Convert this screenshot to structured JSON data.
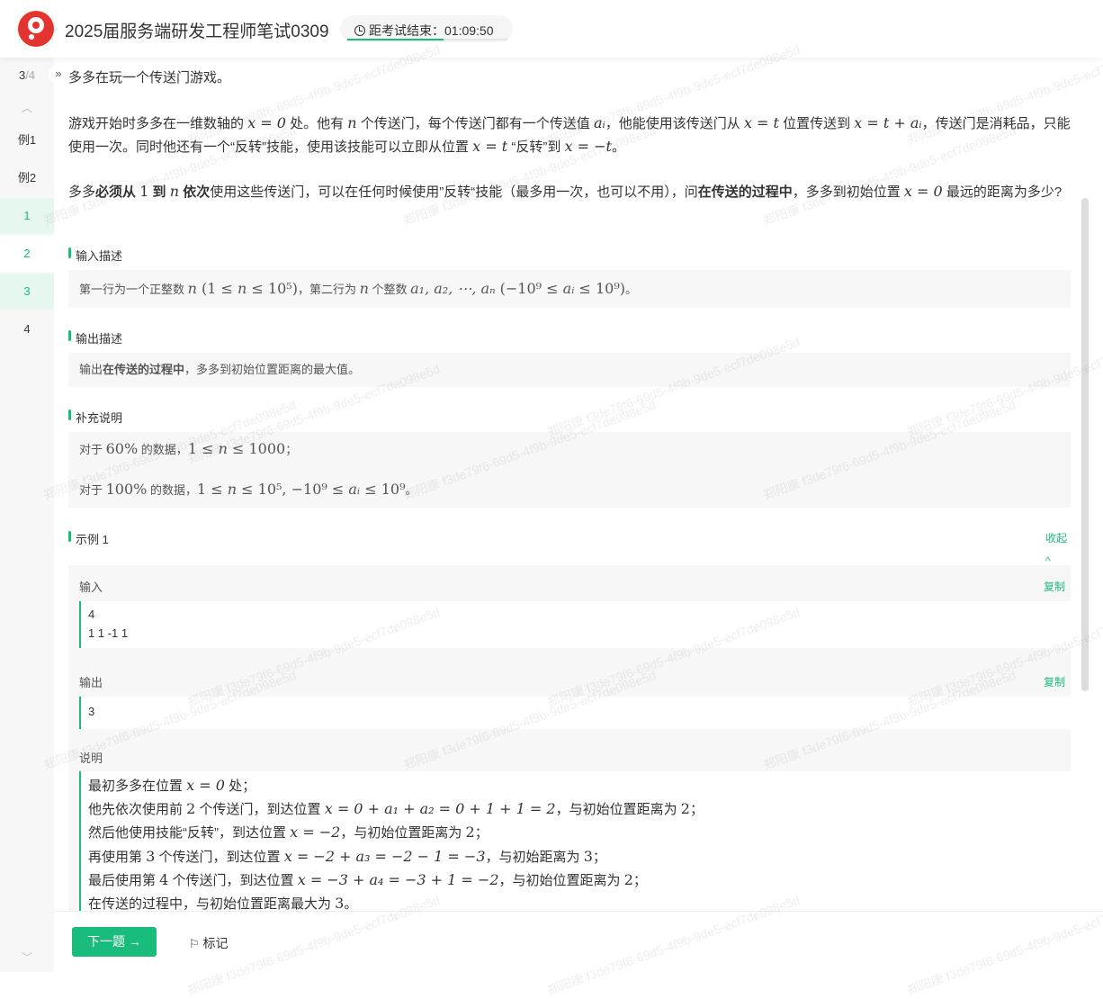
{
  "header": {
    "title": "2025届服务端研发工程师笔试0309",
    "timer_label": "距考试结束：",
    "timer_value": "01:09:50",
    "timer_progress": 0.6
  },
  "sidebar": {
    "progress_current": "3",
    "progress_total": "/4",
    "items": [
      "例1",
      "例2",
      "1",
      "2",
      "3",
      "4"
    ]
  },
  "problem": {
    "p1": "多多在玩一个传送门游戏。",
    "p2": [
      [
        "t",
        "游戏开始时多多在一维数轴的 "
      ],
      [
        "m",
        "x = 0"
      ],
      [
        "t",
        " 处。他有 "
      ],
      [
        "m",
        "n"
      ],
      [
        "t",
        " 个传送门，每个传送门都有一个传送值 "
      ],
      [
        "m",
        "aᵢ"
      ],
      [
        "t",
        "，他能使用该传送门从 "
      ],
      [
        "m",
        "x = t"
      ],
      [
        "t",
        " 位置传送到 "
      ],
      [
        "m",
        "x = t + aᵢ"
      ],
      [
        "t",
        "，传送门是消耗品，只能使用一次。同时他还有一个“反转”技能，使用该技能可以立即从位置 "
      ],
      [
        "m",
        "x = t"
      ],
      [
        "t",
        " “反转”到 "
      ],
      [
        "m",
        "x = −t"
      ],
      [
        "t",
        "。"
      ]
    ],
    "p3": [
      [
        "t",
        "多多"
      ],
      [
        "b",
        "必须从 "
      ],
      [
        "mn",
        "1"
      ],
      [
        "b",
        " 到 "
      ],
      [
        "m",
        "n"
      ],
      [
        "b",
        " 依次"
      ],
      [
        "t",
        "使用这些传送门，可以在任何时候使用”反转“技能（最多用一次，也可以不用），问"
      ],
      [
        "b",
        "在传送的过程中"
      ],
      [
        "t",
        "，多多到初始位置 "
      ],
      [
        "m",
        "x = 0"
      ],
      [
        "t",
        " 最远的距离为多少?"
      ]
    ]
  },
  "input_desc": {
    "title": "输入描述",
    "body": [
      [
        "t",
        "第一行为一个正整数 "
      ],
      [
        "m",
        "n"
      ],
      [
        "mn",
        " (1 ≤ "
      ],
      [
        "m",
        "n"
      ],
      [
        "mn",
        " ≤ 10⁵)"
      ],
      [
        "t",
        "，第二行为 "
      ],
      [
        "m",
        "n"
      ],
      [
        "t",
        " 个整数 "
      ],
      [
        "m",
        "a₁, a₂, ⋯, aₙ"
      ],
      [
        "mn",
        " (−10⁹ ≤ "
      ],
      [
        "m",
        "aᵢ"
      ],
      [
        "mn",
        " ≤ 10⁹)"
      ],
      [
        "t",
        "。"
      ]
    ]
  },
  "output_desc": {
    "title": "输出描述",
    "body": [
      [
        "t",
        "输出"
      ],
      [
        "b",
        "在传送的过程中"
      ],
      [
        "t",
        "，多多到初始位置距离的最大值。"
      ]
    ]
  },
  "notes": {
    "title": "补充说明",
    "lines": [
      [
        [
          "t",
          "对于 "
        ],
        [
          "mn",
          "60%"
        ],
        [
          "t",
          " 的数据，"
        ],
        [
          "mn",
          "1 ≤ "
        ],
        [
          "m",
          "n"
        ],
        [
          "mn",
          " ≤ 1000"
        ],
        [
          "t",
          "；"
        ]
      ],
      [
        [
          "t",
          "对于 "
        ],
        [
          "mn",
          "100%"
        ],
        [
          "t",
          " 的数据，"
        ],
        [
          "mn",
          "1 ≤ "
        ],
        [
          "m",
          "n"
        ],
        [
          "mn",
          " ≤ 10⁵, −10⁹ ≤ "
        ],
        [
          "m",
          "aᵢ"
        ],
        [
          "mn",
          " ≤ 10⁹"
        ],
        [
          "t",
          "。"
        ]
      ]
    ]
  },
  "example": {
    "title": "示例 1",
    "collapse": "收起",
    "input_label": "输入",
    "output_label": "输出",
    "copy": "复制",
    "input_lines": [
      "4",
      "1 1 -1 1"
    ],
    "output_lines": [
      "3"
    ],
    "explain_label": "说明",
    "explain": [
      [
        [
          "t",
          "最初多多在位置 "
        ],
        [
          "m",
          "x = 0"
        ],
        [
          "t",
          " 处；"
        ]
      ],
      [
        [
          "t",
          "他先依次使用前 "
        ],
        [
          "mn",
          "2"
        ],
        [
          "t",
          " 个传送门，到达位置 "
        ],
        [
          "m",
          "x = 0 + a₁ + a₂ = 0 + 1 + 1 = 2"
        ],
        [
          "t",
          "，与初始位置距离为 "
        ],
        [
          "mn",
          "2"
        ],
        [
          "t",
          "；"
        ]
      ],
      [
        [
          "t",
          "然后他使用技能“反转”，到达位置 "
        ],
        [
          "m",
          "x = −2"
        ],
        [
          "t",
          "，与初始位置距离为 "
        ],
        [
          "mn",
          "2"
        ],
        [
          "t",
          "；"
        ]
      ],
      [
        [
          "t",
          "再使用第 "
        ],
        [
          "mn",
          "3"
        ],
        [
          "t",
          " 个传送门，到达位置 "
        ],
        [
          "m",
          "x = −2 + a₃ = −2 − 1 = −3"
        ],
        [
          "t",
          "，与初始距离为 "
        ],
        [
          "mn",
          "3"
        ],
        [
          "t",
          "；"
        ]
      ],
      [
        [
          "t",
          "最后使用第 "
        ],
        [
          "mn",
          "4"
        ],
        [
          "t",
          " 个传送门，到达位置 "
        ],
        [
          "m",
          "x = −3 + a₄ = −3 + 1 = −2"
        ],
        [
          "t",
          "，与初始位置距离为 "
        ],
        [
          "mn",
          "2"
        ],
        [
          "t",
          "；"
        ]
      ],
      [
        [
          "t",
          "在传送的过程中，与初始位置距离最大为 "
        ],
        [
          "mn",
          "3"
        ],
        [
          "t",
          "。"
        ]
      ]
    ]
  },
  "footer": {
    "next": "下一题 →",
    "mark": "标记"
  },
  "watermark": "郑阳康 f3de79f6-69d5-4f9b-9de5-ecf7de098e5d",
  "colors": {
    "accent": "#1abc7b",
    "logo": "#e3342f"
  }
}
